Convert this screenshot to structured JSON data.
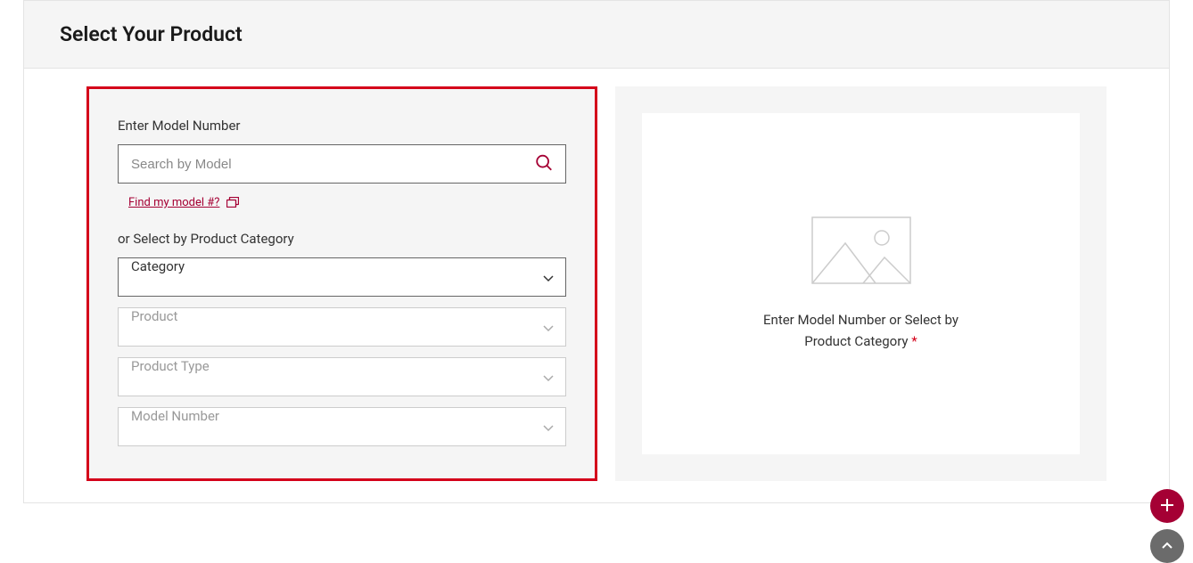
{
  "header": {
    "title": "Select Your Product"
  },
  "form": {
    "model_label": "Enter Model Number",
    "search_placeholder": "Search by Model",
    "find_link": "Find my model #?",
    "category_label": "or Select by Product Category",
    "selects": {
      "category": "Category",
      "product": "Product",
      "product_type": "Product Type",
      "model_number": "Model Number"
    }
  },
  "preview": {
    "text_line1": "Enter Model Number or Select by",
    "text_line2": "Product Category",
    "asterisk": "*"
  },
  "colors": {
    "accent": "#a50034",
    "highlight": "#d4011a"
  }
}
